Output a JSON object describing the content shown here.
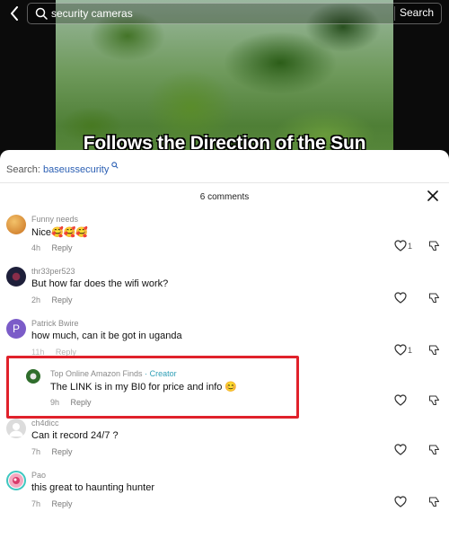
{
  "topbar": {
    "search_query": "security cameras",
    "search_button": "Search"
  },
  "video": {
    "caption": "Follows the Direction of the Sun"
  },
  "sheet": {
    "related_search_label": "Search:",
    "related_search_keyword": "baseussecurity",
    "comment_count": "6 comments"
  },
  "comments": [
    {
      "username": "Funny needs",
      "text": "Nice🥰🥰🥰",
      "time": "4h",
      "reply": "Reply",
      "likes": "1",
      "avatar_color": "#e0912e"
    },
    {
      "username": "thr33per523",
      "text": "But how far does the wifi work?",
      "time": "2h",
      "reply": "Reply",
      "likes": "",
      "avatar_color": "#1e1f3a"
    },
    {
      "username": "Patrick Bwire",
      "text": "how much, can it be got in uganda",
      "time": "11h",
      "reply": "Reply",
      "likes": "1",
      "avatar_color": "#7b5cc8",
      "avatar_letter": "P"
    },
    {
      "username": "Top  Online  Amazon  Finds",
      "creator_tag": "· Creator",
      "text": "The LINK is in my BI0 for price and info 😊",
      "time": "9h",
      "reply": "Reply",
      "likes": "",
      "avatar_color": "#2f6d2c"
    },
    {
      "username": "ch4dicc",
      "text": "Can it record 24/7 ?",
      "time": "7h",
      "reply": "Reply",
      "likes": "",
      "avatar_color": "#d8d8d8"
    },
    {
      "username": "Pao",
      "text": "this great to haunting hunter",
      "time": "7h",
      "reply": "Reply",
      "likes": "",
      "avatar_color": "#e3557a"
    }
  ]
}
